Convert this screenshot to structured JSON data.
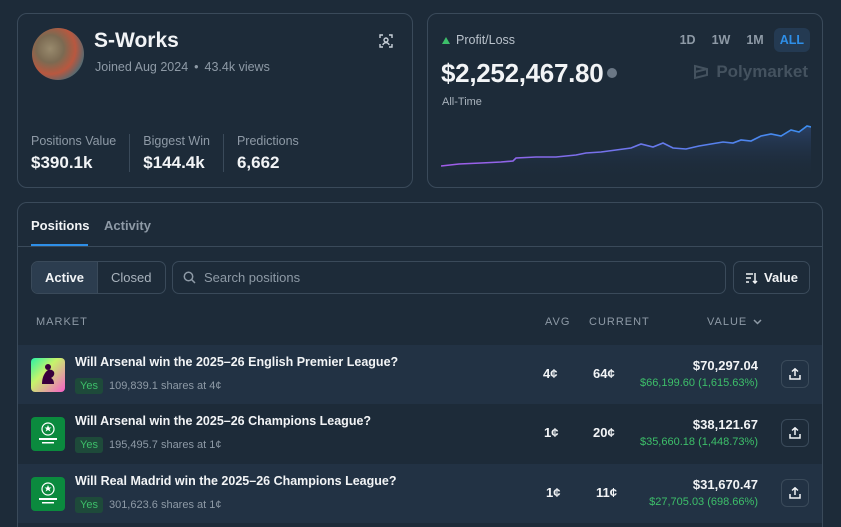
{
  "profile": {
    "name": "S-Works",
    "joined": "Joined Aug 2024",
    "views": "43.4k views",
    "stats": [
      {
        "label": "Positions Value",
        "value": "$390.1k"
      },
      {
        "label": "Biggest Win",
        "value": "$144.4k"
      },
      {
        "label": "Predictions",
        "value": "6,662"
      }
    ]
  },
  "pnl": {
    "label": "Profit/Loss",
    "value": "$2,252,467.80",
    "period_label": "All-Time",
    "brand": "Polymarket",
    "ranges": [
      "1D",
      "1W",
      "1M",
      "ALL"
    ],
    "active_range": "ALL",
    "colors": {
      "up": "#3dbf6a",
      "accent": "#2e8fe8"
    }
  },
  "positions": {
    "tabs": [
      "Positions",
      "Activity"
    ],
    "filter": {
      "active": "Active",
      "closed": "Closed"
    },
    "search_placeholder": "Search positions",
    "sort_label": "Value",
    "columns": {
      "market": "MARKET",
      "avg": "AVG",
      "current": "CURRENT",
      "value": "VALUE"
    },
    "rows": [
      {
        "title": "Will Arsenal win the 2025–26 English Premier League?",
        "outcome": "Yes",
        "shares": "109,839.1 shares at 4¢",
        "avg": "4¢",
        "current": "64¢",
        "value": "$70,297.04",
        "pnl": "$66,199.60 (1,615.63%)",
        "icon": "premier-league-icon"
      },
      {
        "title": "Will Arsenal win the 2025–26 Champions League?",
        "outcome": "Yes",
        "shares": "195,495.7 shares at 1¢",
        "avg": "1¢",
        "current": "20¢",
        "value": "$38,121.67",
        "pnl": "$35,660.18 (1,448.73%)",
        "icon": "champions-league-icon"
      },
      {
        "title": "Will Real Madrid win the 2025–26 Champions League?",
        "outcome": "Yes",
        "shares": "301,623.6 shares at 1¢",
        "avg": "1¢",
        "current": "11¢",
        "value": "$31,670.47",
        "pnl": "$27,705.03 (698.66%)",
        "icon": "champions-league-icon"
      }
    ]
  }
}
